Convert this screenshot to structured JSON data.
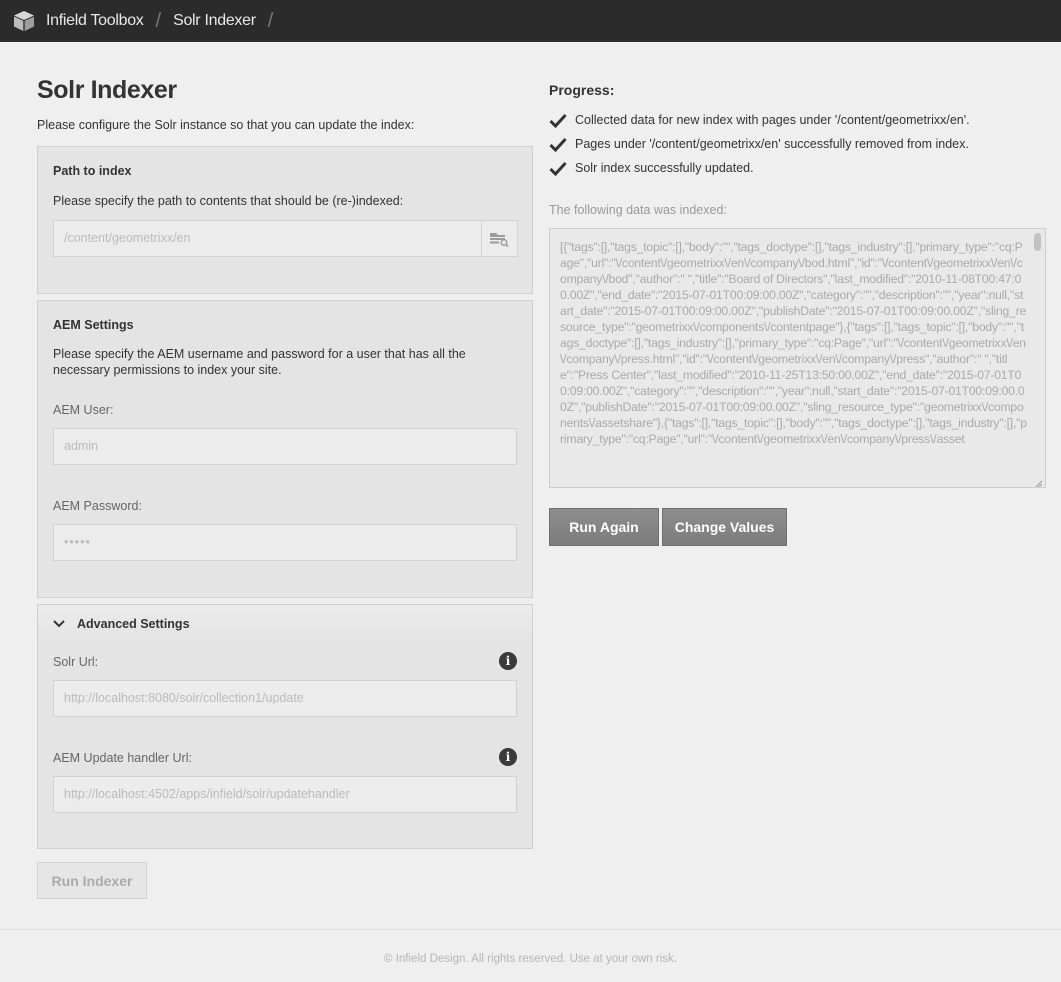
{
  "breadcrumb": {
    "app": "Infield Toolbox",
    "page": "Solr Indexer",
    "separator": "/"
  },
  "main": {
    "title": "Solr Indexer",
    "intro": "Please configure the Solr instance so that you can update the index:"
  },
  "path_panel": {
    "title": "Path to index",
    "description": "Please specify the path to contents that should be (re-)indexed:",
    "path_value": "/content/geometrixx/en"
  },
  "aem_panel": {
    "title": "AEM Settings",
    "description": "Please specify the AEM username and password for a user that has all the necessary permissions to index your site.",
    "user_label": "AEM User:",
    "user_value": "admin",
    "password_label": "AEM Password:",
    "password_value": "•••••"
  },
  "advanced_panel": {
    "title": "Advanced Settings",
    "solr_url_label": "Solr Url:",
    "solr_url_value": "http://localhost:8080/solr/collection1/update",
    "handler_url_label": "AEM Update handler Url:",
    "handler_url_value": "http://localhost:4502/apps/infield/solr/updatehandler",
    "info_glyph": "i"
  },
  "run_indexer_label": "Run Indexer",
  "progress": {
    "title": "Progress:",
    "items": [
      "Collected data for new index with pages under '/content/geometrixx/en'.",
      "Pages under '/content/geometrixx/en' successfully removed from index.",
      "Solr index successfully updated."
    ],
    "data_label": "The following data was indexed:",
    "data_text": "[{\"tags\":[],\"tags_topic\":[],\"body\":\"\",\"tags_doctype\":[],\"tags_industry\":[],\"primary_type\":\"cq:Page\",\"url\":\"\\/content\\/geometrixx\\/en\\/company\\/bod.html\",\"id\":\"\\/content\\/geometrixx\\/en\\/company\\/bod\",\"author\":\" \",\"title\":\"Board of Directors\",\"last_modified\":\"2010-11-08T00:47:00.00Z\",\"end_date\":\"2015-07-01T00:09:00.00Z\",\"category\":\"\",\"description\":\"\",\"year\":null,\"start_date\":\"2015-07-01T00:09:00.00Z\",\"publishDate\":\"2015-07-01T00:09:00.00Z\",\"sling_resource_type\":\"geometrixx\\/components\\/contentpage\"},{\"tags\":[],\"tags_topic\":[],\"body\":\"\",\"tags_doctype\":[],\"tags_industry\":[],\"primary_type\":\"cq:Page\",\"url\":\"\\/content\\/geometrixx\\/en\\/company\\/press.html\",\"id\":\"\\/content\\/geometrixx\\/en\\/company\\/press\",\"author\":\" \",\"title\":\"Press Center\",\"last_modified\":\"2010-11-25T13:50:00.00Z\",\"end_date\":\"2015-07-01T00:09:00.00Z\",\"category\":\"\",\"description\":\"\",\"year\":null,\"start_date\":\"2015-07-01T00:09:00.00Z\",\"publishDate\":\"2015-07-01T00:09:00.00Z\",\"sling_resource_type\":\"geometrixx\\/components\\/assetshare\"},{\"tags\":[],\"tags_topic\":[],\"body\":\"\",\"tags_doctype\":[],\"tags_industry\":[],\"primary_type\":\"cq:Page\",\"url\":\"\\/content\\/geometrixx\\/en\\/company\\/press\\/asset"
  },
  "actions": {
    "run_again": "Run Again",
    "change_values": "Change Values"
  },
  "footer": "© Infield Design. All rights reserved. Use at your own risk.",
  "colors": {
    "topbar": "#2b2b2b",
    "background": "#efefef",
    "panel": "#e4e4e4",
    "button_dark": "#858585"
  }
}
